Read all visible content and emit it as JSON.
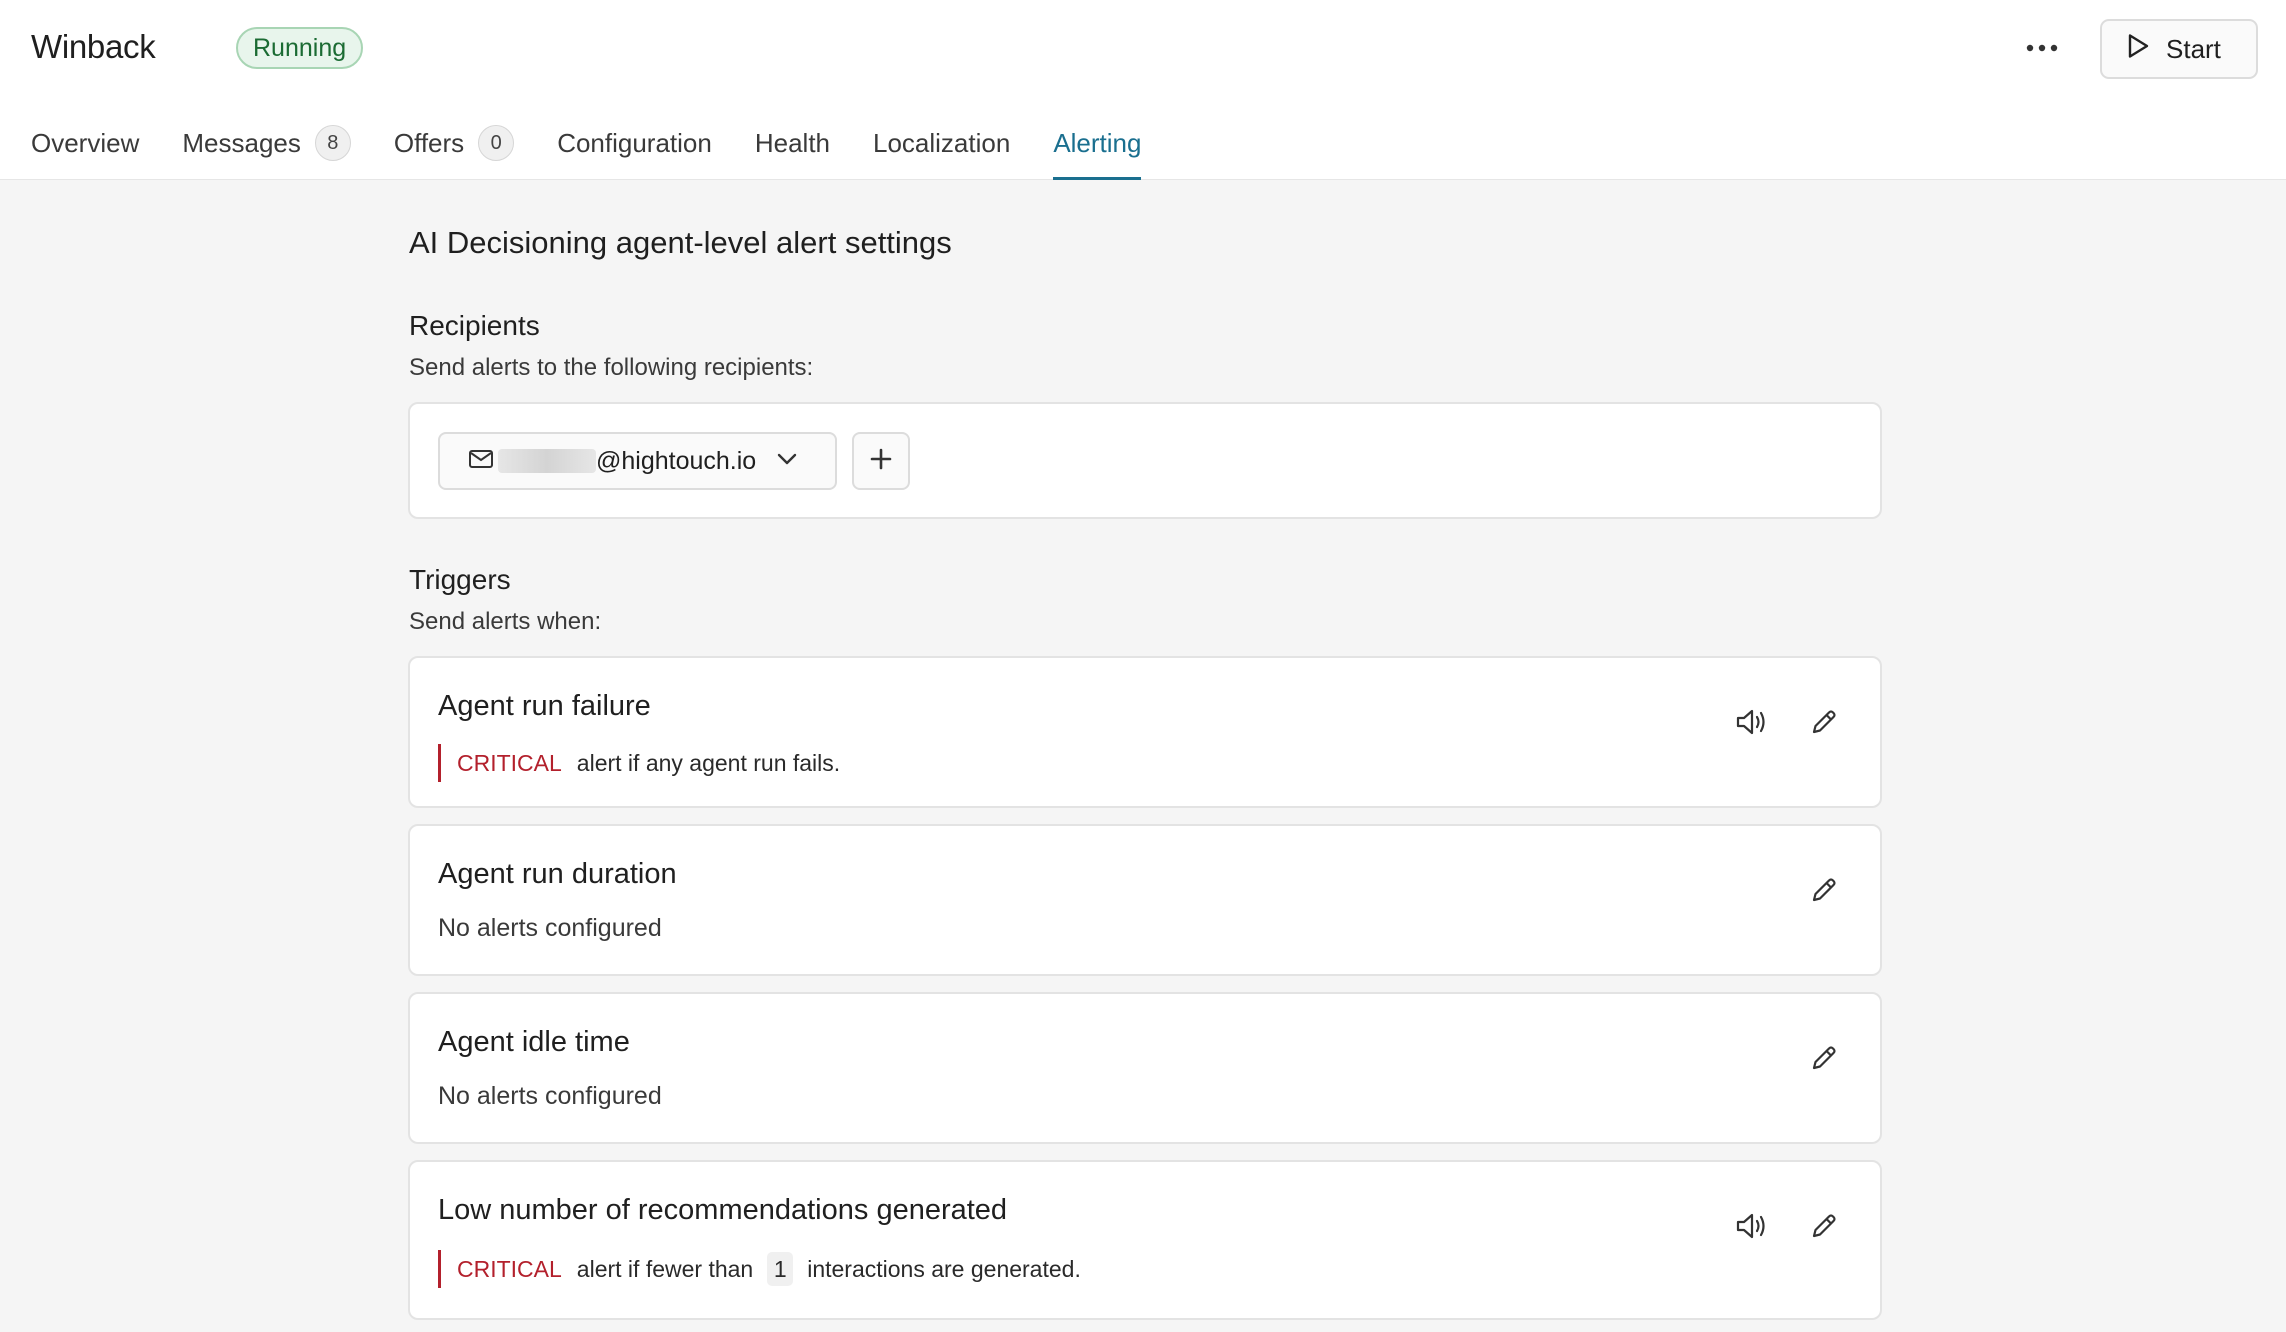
{
  "header": {
    "title": "Winback",
    "status": "Running",
    "start_label": "Start"
  },
  "tabs": [
    {
      "label": "Overview"
    },
    {
      "label": "Messages",
      "count": "8"
    },
    {
      "label": "Offers",
      "count": "0"
    },
    {
      "label": "Configuration"
    },
    {
      "label": "Health"
    },
    {
      "label": "Localization"
    },
    {
      "label": "Alerting",
      "active": true
    }
  ],
  "page": {
    "title": "AI Decisioning agent-level alert settings"
  },
  "recipients": {
    "title": "Recipients",
    "subtitle": "Send alerts to the following recipients:",
    "email": "@hightouch.io"
  },
  "triggers": {
    "title": "Triggers",
    "subtitle": "Send alerts when:",
    "items": [
      {
        "name": "Agent run failure",
        "severity": "CRITICAL",
        "text": "alert if any agent run fails."
      },
      {
        "name": "Agent run duration",
        "empty": "No alerts configured"
      },
      {
        "name": "Agent idle time",
        "empty": "No alerts configured"
      },
      {
        "name": "Low number of recommendations generated",
        "severity": "CRITICAL",
        "text_before": "alert if fewer than",
        "threshold": "1",
        "text_after": "interactions are generated."
      }
    ]
  },
  "colors": {
    "accent": "#1a6f8f",
    "critical": "#b3202c",
    "running_bg": "#e8f5ec",
    "running_text": "#1b6b33"
  }
}
